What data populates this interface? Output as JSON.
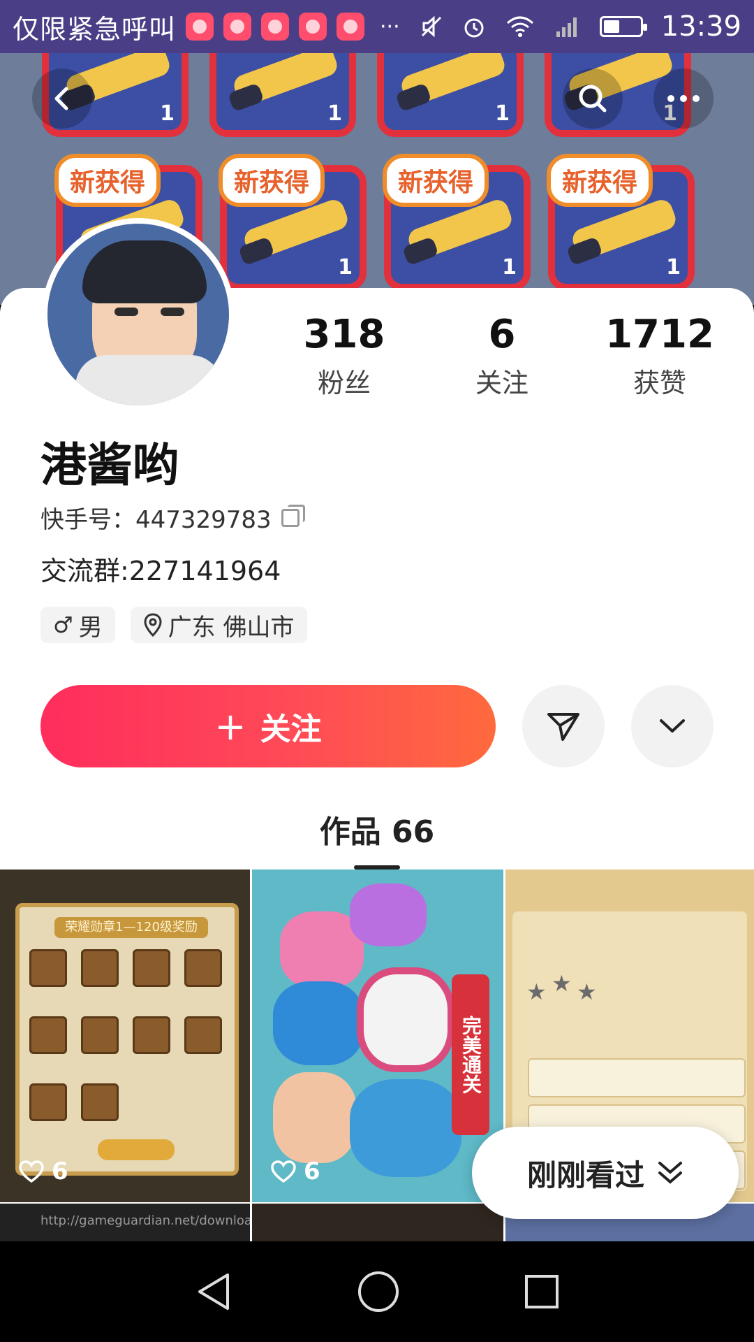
{
  "status_bar": {
    "notification_text": "仅限紧急呼叫",
    "more": "···",
    "time": "13:39"
  },
  "header": {
    "back_icon": "back-arrow-icon",
    "search_icon": "search-icon",
    "more_icon": "more-dots-icon",
    "banner_tag": "新获得",
    "banner_count": "1"
  },
  "profile": {
    "stats": [
      {
        "value": "318",
        "label": "粉丝"
      },
      {
        "value": "6",
        "label": "关注"
      },
      {
        "value": "1712",
        "label": "获赞"
      }
    ],
    "nickname": "港酱哟",
    "kuaishou_id": "快手号：447329783",
    "group": "交流群:227141964",
    "gender": "男",
    "location": "广东 佛山市"
  },
  "actions": {
    "follow_label": "关注",
    "follow_plus": "+"
  },
  "tabs": {
    "works": "作品 66"
  },
  "grid": {
    "items": [
      {
        "likes": "6"
      },
      {
        "likes": "6"
      }
    ],
    "thumb1_title": "荣耀勋章1—120级奖励",
    "thumb2_badge": "完美通关",
    "row2_text": "http://gameguardian.net/download"
  },
  "recent": {
    "label": "刚刚看过"
  },
  "colors": {
    "status_bar": "#4a3f86",
    "follow_start": "#ff2d5d",
    "follow_end": "#ff6a3d"
  }
}
